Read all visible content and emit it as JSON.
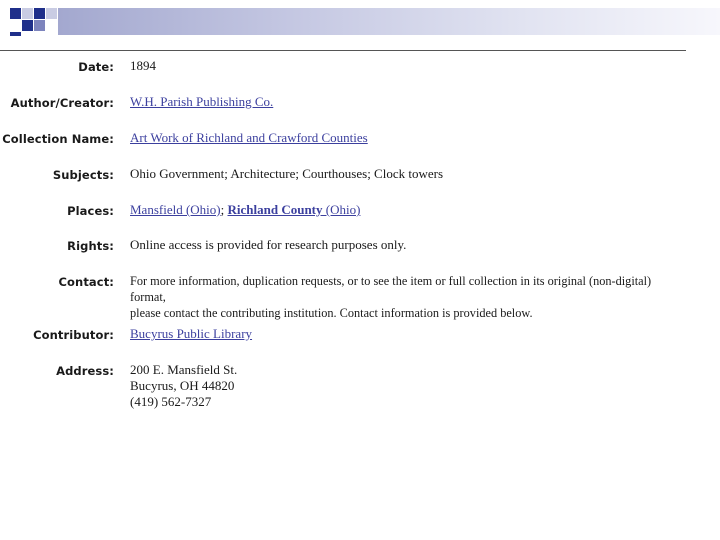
{
  "record": {
    "date": {
      "label": "Date:",
      "value": "1894"
    },
    "author": {
      "label": "Author/Creator:",
      "value": "W.H. Parish Publishing Co."
    },
    "collection": {
      "label": "Collection Name:",
      "value": "Art Work of Richland and Crawford Counties"
    },
    "subjects": {
      "label": "Subjects:",
      "value": "Ohio Government; Architecture; Courthouses; Clock towers"
    },
    "places": {
      "label": "Places:",
      "link1": "Mansfield (Ohio)",
      "separator": "; ",
      "link2_bold": "Richland County",
      "link2_rest": " (Ohio)"
    },
    "rights": {
      "label": "Rights:",
      "value": "Online access is provided for research purposes only."
    },
    "contact": {
      "label": "Contact:",
      "line1": "For more information, duplication requests, or to see the item or full collection in its original (non-digital) format,",
      "line2": "please contact the contributing institution. Contact information is provided below."
    },
    "contributor": {
      "label": "Contributor:",
      "value": "Bucyrus Public Library"
    },
    "address": {
      "label": "Address:",
      "line1": "200 E. Mansfield St.",
      "line2": "Bucyrus, OH 44820",
      "line3": "(419) 562-7327"
    }
  }
}
